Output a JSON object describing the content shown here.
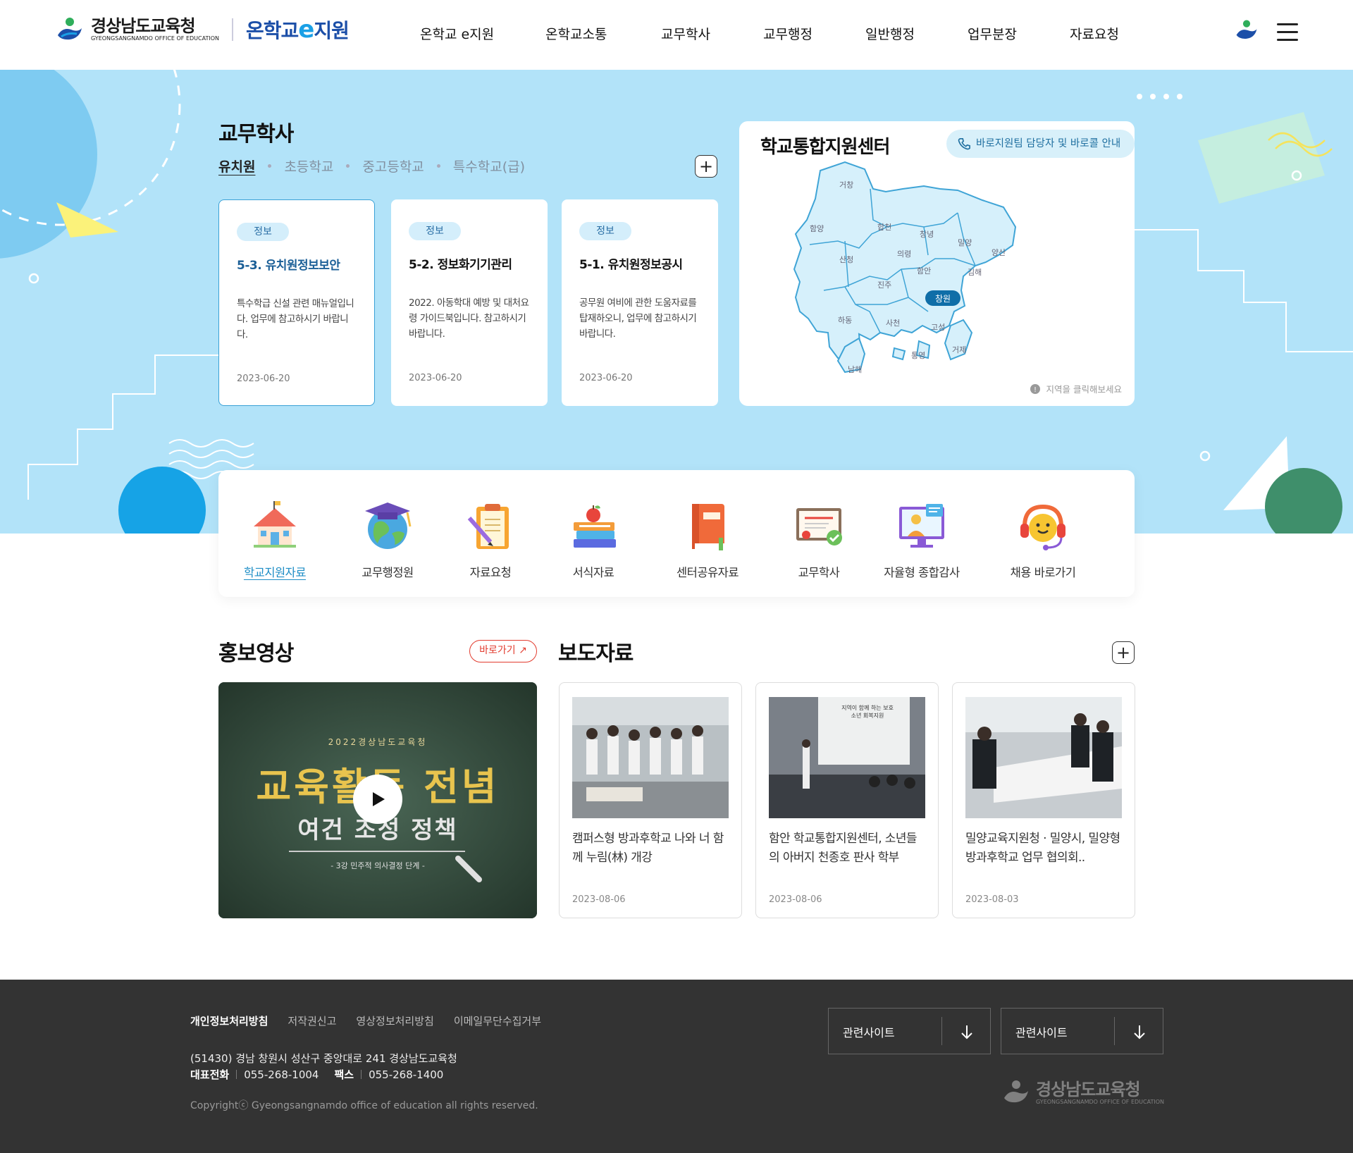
{
  "header": {
    "logo_ko": "경상남도교육청",
    "logo_en": "GYEONGSANGNAMDO OFFICE OF EDUCATION",
    "site_pre": "온학교",
    "site_e": "e",
    "site_post": "지원",
    "nav": [
      "온학교 e지원",
      "온학교소통",
      "교무학사",
      "교무행정",
      "일반행정",
      "업무분장",
      "자료요청"
    ]
  },
  "academic": {
    "title": "교무학사",
    "tabs": [
      "유치원",
      "초등학교",
      "중고등학교",
      "특수학교(급)"
    ],
    "active_tab": 0,
    "cards": [
      {
        "badge": "정보",
        "title": "5-3. 유치원정보보안",
        "desc": "특수학급 신설 관련 매뉴얼입니다. 업무에 참고하시기 바랍니다.",
        "date": "2023-06-20"
      },
      {
        "badge": "정보",
        "title": "5-2. 정보화기기관리",
        "desc": "2022. 아동학대 예방 및 대처요령 가이드북입니다. 참고하시기 바랍니다.",
        "date": "2023-06-20"
      },
      {
        "badge": "정보",
        "title": "5-1. 유치원정보공시",
        "desc": "공무원 여비에 관한 도움자료를 탑재하오니, 업무에 참고하시기 바랍니다.",
        "date": "2023-06-20"
      }
    ]
  },
  "map": {
    "title": "학교통합지원센터",
    "button": "바로지원팀 담당자 및 바로콜 안내",
    "hint": "지역을 클릭해보세요",
    "regions": [
      "거창",
      "함양",
      "합천",
      "창녕",
      "밀양",
      "양산",
      "산청",
      "의령",
      "함안",
      "김해",
      "진주",
      "창원",
      "하동",
      "사천",
      "고성",
      "거제",
      "통영",
      "남해"
    ],
    "selected": "창원"
  },
  "quick": [
    {
      "label": "학교지원자료",
      "icon": "school-icon"
    },
    {
      "label": "교무행정원",
      "icon": "globe-graduation-icon"
    },
    {
      "label": "자료요청",
      "icon": "clipboard-pencil-icon"
    },
    {
      "label": "서식자료",
      "icon": "books-apple-icon"
    },
    {
      "label": "센터공유자료",
      "icon": "notebook-icon"
    },
    {
      "label": "교무학사",
      "icon": "certificate-icon"
    },
    {
      "label": "자율형 종합감사",
      "icon": "monitor-person-icon"
    },
    {
      "label": "채용 바로가기",
      "icon": "headset-icon"
    }
  ],
  "promo": {
    "title": "홍보영상",
    "link": "바로가기",
    "video_top": "2022경상남도교육청",
    "video_main": "교육활동 전념",
    "video_sub": "여건 조성 정책",
    "video_small": "- 3강 민주적 의사결정 단계 -"
  },
  "press": {
    "title": "보도자료",
    "items": [
      {
        "title": "캠퍼스형 방과후학교 나와 너 함께 누림(林) 개강",
        "date": "2023-08-06"
      },
      {
        "title": "함안 학교통합지원센터, 소년들의 아버지 천종호 판사 학부",
        "date": "2023-08-06",
        "slide_text": "지역이 함께 하는 보호소년 회복지원"
      },
      {
        "title": "밀양교육지원청 · 밀양시, 밀양형 방과후학교 업무 협의회..",
        "date": "2023-08-03"
      }
    ]
  },
  "footer": {
    "links": [
      "개인정보처리방침",
      "저작권신고",
      "영상정보처리방침",
      "이메일무단수집거부"
    ],
    "address": "(51430) 경남 창원시 성산구 중앙대로 241 경상남도교육청",
    "phone_label": "대표전화",
    "phone": "055-268-1004",
    "fax_label": "팩스",
    "fax": "055-268-1400",
    "copyright": "Copyrightⓒ Gyeongsangnamdo office of education all rights reserved.",
    "select1": "관련사이트",
    "select2": "관련사이트",
    "logo_ko": "경상남도교육청",
    "logo_en": "GYEONGSANGNAMDO OFFICE OF EDUCATION"
  },
  "colors": {
    "hero_bg": "#b2e3f9",
    "accent_blue": "#1f8ec6",
    "red": "#e23b2e",
    "footer_bg": "#333333"
  }
}
